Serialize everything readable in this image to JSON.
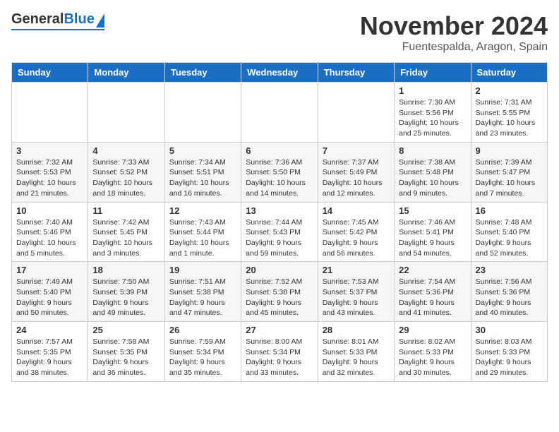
{
  "logo": {
    "general": "General",
    "blue": "Blue"
  },
  "header": {
    "month": "November 2024",
    "location": "Fuentespalda, Aragon, Spain"
  },
  "days_of_week": [
    "Sunday",
    "Monday",
    "Tuesday",
    "Wednesday",
    "Thursday",
    "Friday",
    "Saturday"
  ],
  "weeks": [
    [
      {
        "day": "",
        "info": ""
      },
      {
        "day": "",
        "info": ""
      },
      {
        "day": "",
        "info": ""
      },
      {
        "day": "",
        "info": ""
      },
      {
        "day": "",
        "info": ""
      },
      {
        "day": "1",
        "info": "Sunrise: 7:30 AM\nSunset: 5:56 PM\nDaylight: 10 hours\nand 25 minutes."
      },
      {
        "day": "2",
        "info": "Sunrise: 7:31 AM\nSunset: 5:55 PM\nDaylight: 10 hours\nand 23 minutes."
      }
    ],
    [
      {
        "day": "3",
        "info": "Sunrise: 7:32 AM\nSunset: 5:53 PM\nDaylight: 10 hours\nand 21 minutes."
      },
      {
        "day": "4",
        "info": "Sunrise: 7:33 AM\nSunset: 5:52 PM\nDaylight: 10 hours\nand 18 minutes."
      },
      {
        "day": "5",
        "info": "Sunrise: 7:34 AM\nSunset: 5:51 PM\nDaylight: 10 hours\nand 16 minutes."
      },
      {
        "day": "6",
        "info": "Sunrise: 7:36 AM\nSunset: 5:50 PM\nDaylight: 10 hours\nand 14 minutes."
      },
      {
        "day": "7",
        "info": "Sunrise: 7:37 AM\nSunset: 5:49 PM\nDaylight: 10 hours\nand 12 minutes."
      },
      {
        "day": "8",
        "info": "Sunrise: 7:38 AM\nSunset: 5:48 PM\nDaylight: 10 hours\nand 9 minutes."
      },
      {
        "day": "9",
        "info": "Sunrise: 7:39 AM\nSunset: 5:47 PM\nDaylight: 10 hours\nand 7 minutes."
      }
    ],
    [
      {
        "day": "10",
        "info": "Sunrise: 7:40 AM\nSunset: 5:46 PM\nDaylight: 10 hours\nand 5 minutes."
      },
      {
        "day": "11",
        "info": "Sunrise: 7:42 AM\nSunset: 5:45 PM\nDaylight: 10 hours\nand 3 minutes."
      },
      {
        "day": "12",
        "info": "Sunrise: 7:43 AM\nSunset: 5:44 PM\nDaylight: 10 hours\nand 1 minute."
      },
      {
        "day": "13",
        "info": "Sunrise: 7:44 AM\nSunset: 5:43 PM\nDaylight: 9 hours\nand 59 minutes."
      },
      {
        "day": "14",
        "info": "Sunrise: 7:45 AM\nSunset: 5:42 PM\nDaylight: 9 hours\nand 56 minutes."
      },
      {
        "day": "15",
        "info": "Sunrise: 7:46 AM\nSunset: 5:41 PM\nDaylight: 9 hours\nand 54 minutes."
      },
      {
        "day": "16",
        "info": "Sunrise: 7:48 AM\nSunset: 5:40 PM\nDaylight: 9 hours\nand 52 minutes."
      }
    ],
    [
      {
        "day": "17",
        "info": "Sunrise: 7:49 AM\nSunset: 5:40 PM\nDaylight: 9 hours\nand 50 minutes."
      },
      {
        "day": "18",
        "info": "Sunrise: 7:50 AM\nSunset: 5:39 PM\nDaylight: 9 hours\nand 49 minutes."
      },
      {
        "day": "19",
        "info": "Sunrise: 7:51 AM\nSunset: 5:38 PM\nDaylight: 9 hours\nand 47 minutes."
      },
      {
        "day": "20",
        "info": "Sunrise: 7:52 AM\nSunset: 5:38 PM\nDaylight: 9 hours\nand 45 minutes."
      },
      {
        "day": "21",
        "info": "Sunrise: 7:53 AM\nSunset: 5:37 PM\nDaylight: 9 hours\nand 43 minutes."
      },
      {
        "day": "22",
        "info": "Sunrise: 7:54 AM\nSunset: 5:36 PM\nDaylight: 9 hours\nand 41 minutes."
      },
      {
        "day": "23",
        "info": "Sunrise: 7:56 AM\nSunset: 5:36 PM\nDaylight: 9 hours\nand 40 minutes."
      }
    ],
    [
      {
        "day": "24",
        "info": "Sunrise: 7:57 AM\nSunset: 5:35 PM\nDaylight: 9 hours\nand 38 minutes."
      },
      {
        "day": "25",
        "info": "Sunrise: 7:58 AM\nSunset: 5:35 PM\nDaylight: 9 hours\nand 36 minutes."
      },
      {
        "day": "26",
        "info": "Sunrise: 7:59 AM\nSunset: 5:34 PM\nDaylight: 9 hours\nand 35 minutes."
      },
      {
        "day": "27",
        "info": "Sunrise: 8:00 AM\nSunset: 5:34 PM\nDaylight: 9 hours\nand 33 minutes."
      },
      {
        "day": "28",
        "info": "Sunrise: 8:01 AM\nSunset: 5:33 PM\nDaylight: 9 hours\nand 32 minutes."
      },
      {
        "day": "29",
        "info": "Sunrise: 8:02 AM\nSunset: 5:33 PM\nDaylight: 9 hours\nand 30 minutes."
      },
      {
        "day": "30",
        "info": "Sunrise: 8:03 AM\nSunset: 5:33 PM\nDaylight: 9 hours\nand 29 minutes."
      }
    ]
  ]
}
